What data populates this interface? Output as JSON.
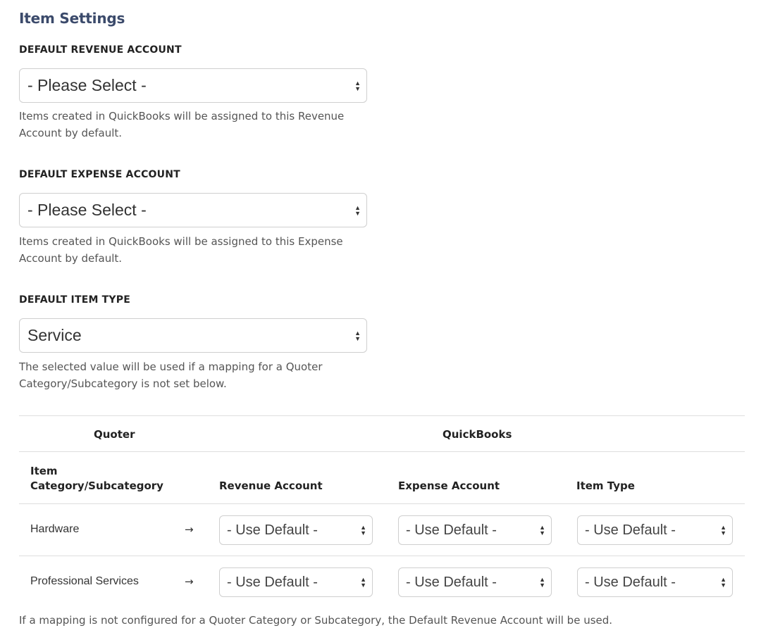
{
  "page": {
    "title": "Item Settings"
  },
  "revenue": {
    "label": "DEFAULT REVENUE ACCOUNT",
    "value": "- Please Select -",
    "help": "Items created in QuickBooks will be assigned to this Revenue Account by default."
  },
  "expense": {
    "label": "DEFAULT EXPENSE ACCOUNT",
    "value": "- Please Select -",
    "help": "Items created in QuickBooks will be assigned to this Expense Account by default."
  },
  "item_type": {
    "label": "DEFAULT ITEM TYPE",
    "value": "Service",
    "help": "The selected value will be used if a mapping for a Quoter Category/Subcategory is not set below."
  },
  "table": {
    "group_quoter": "Quoter",
    "group_quickbooks": "QuickBooks",
    "col_category": "Item Category/Subcategory",
    "col_revenue": "Revenue Account",
    "col_expense": "Expense Account",
    "col_item_type": "Item Type",
    "arrow": "→",
    "rows": [
      {
        "name": "Hardware",
        "revenue": "- Use Default -",
        "expense": "- Use Default -",
        "item_type": "- Use Default -"
      },
      {
        "name": "Professional Services",
        "revenue": "- Use Default -",
        "expense": "- Use Default -",
        "item_type": "- Use Default -"
      }
    ]
  },
  "footnote": "If a mapping is not configured for a Quoter Category or Subcategory, the Default Revenue Account will be used.",
  "icons": {
    "select_arrows": "sort-arrows-icon"
  }
}
